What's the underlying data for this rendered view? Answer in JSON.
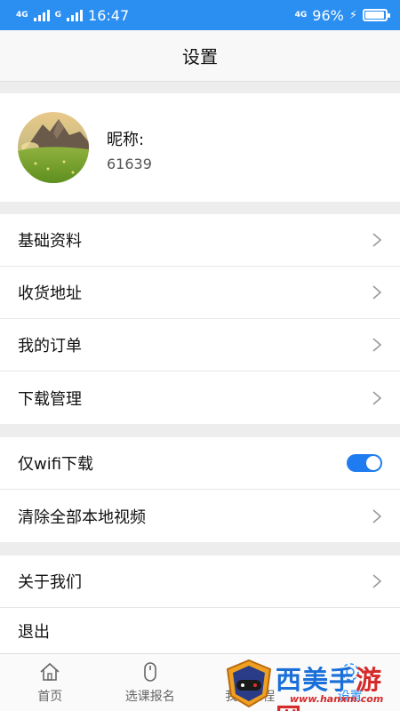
{
  "status_bar": {
    "network_left": "4G",
    "network_left2": "G",
    "time": "16:47",
    "network_right": "4G",
    "battery_percent": "96%",
    "battery_level": 0.96
  },
  "header": {
    "title": "设置"
  },
  "profile": {
    "nickname_label": "昵称:",
    "user_id": "61639"
  },
  "menu_group1": [
    {
      "label": "基础资料"
    },
    {
      "label": "收货地址"
    },
    {
      "label": "我的订单"
    },
    {
      "label": "下载管理"
    }
  ],
  "menu_group2": {
    "wifi_only": {
      "label": "仅wifi下载",
      "enabled": true
    },
    "clear_videos": {
      "label": "清除全部本地视频"
    }
  },
  "menu_group3": [
    {
      "label": "关于我们"
    },
    {
      "label": "退出"
    }
  ],
  "tab_bar": {
    "tabs": [
      {
        "label": "首页",
        "icon": "home-icon"
      },
      {
        "label": "选课报名",
        "icon": "mouse-icon"
      },
      {
        "label": "我的课程",
        "icon": "book-icon"
      },
      {
        "label": "设置",
        "icon": "gear-icon"
      }
    ],
    "active": "设置"
  },
  "watermark": {
    "text_blue": "西美手",
    "text_red": "游网",
    "url": "www.hanxm.com"
  },
  "colors": {
    "accent": "#2b8ff2",
    "toggle_on": "#1f7cf0",
    "background": "#ededed"
  }
}
